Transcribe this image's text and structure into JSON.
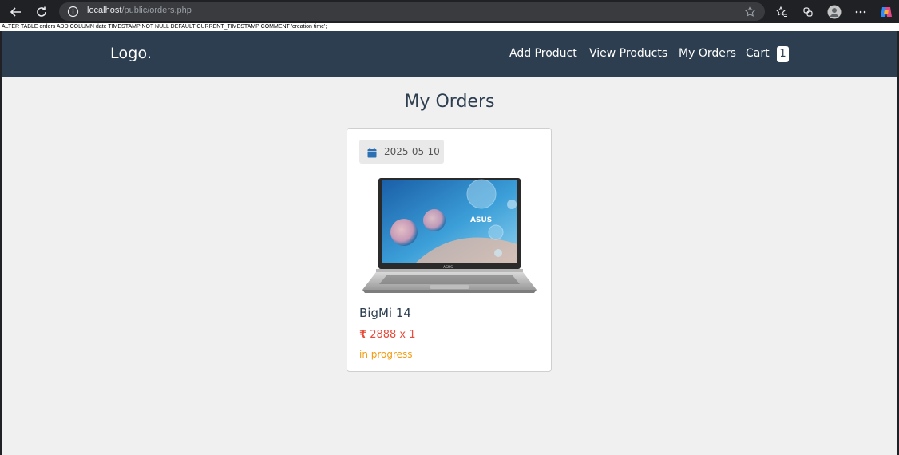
{
  "browser": {
    "url_host": "localhost",
    "url_path": "/public/orders.php"
  },
  "debug": {
    "sql": "ALTER TABLE orders ADD COLUMN date TIMESTAMP NOT NULL DEFAULT CURRENT_TIMESTAMP COMMENT 'creation time';"
  },
  "header": {
    "logo": "Logo.",
    "nav": {
      "add_product": "Add Product",
      "view_products": "View Products",
      "my_orders": "My Orders",
      "cart": "Cart"
    },
    "cart_count": "1"
  },
  "main": {
    "title": "My Orders",
    "orders": [
      {
        "date": "2025-05-10",
        "product_name": "BigMi 14",
        "price_symbol": "₹",
        "price": "2888 x 1",
        "status": "in progress",
        "image_icon": "laptop-product-image",
        "image_brand": "ASUS"
      }
    ]
  },
  "colors": {
    "header_bg": "#2c3e50",
    "price": "#e74c3c",
    "status": "#f39c12",
    "calendar_icon": "#2c6fb3"
  },
  "icons": [
    "back-icon",
    "reload-icon",
    "info-icon",
    "star-icon",
    "favorites-icon",
    "extensions-icon",
    "profile-icon",
    "more-icon",
    "copilot-icon",
    "calendar-icon",
    "rupee-icon"
  ]
}
